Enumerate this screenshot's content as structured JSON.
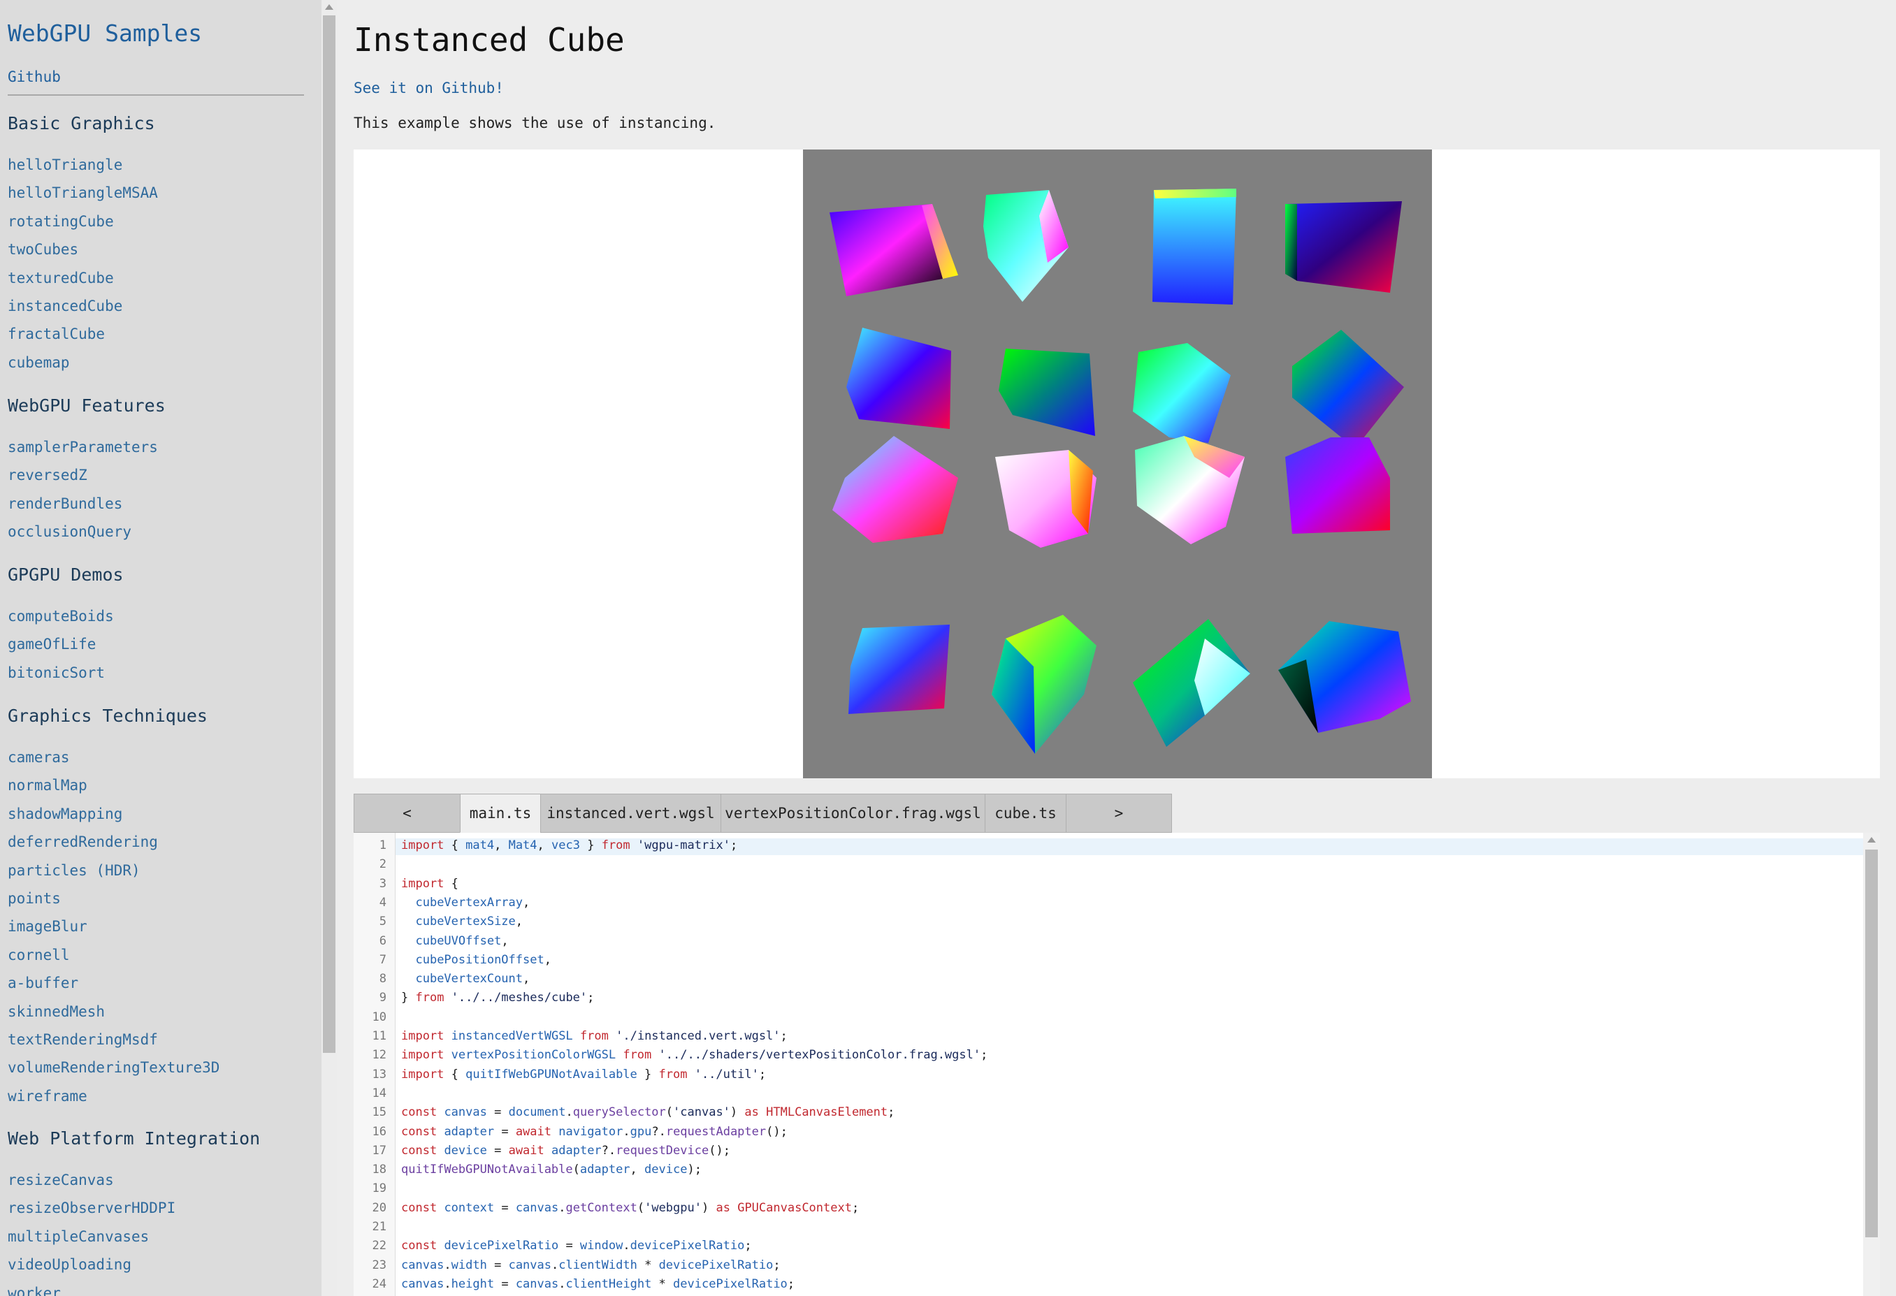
{
  "sidebar": {
    "brand": "WebGPU Samples",
    "github": "Github",
    "sections": [
      {
        "title": "Basic Graphics",
        "items": [
          "helloTriangle",
          "helloTriangleMSAA",
          "rotatingCube",
          "twoCubes",
          "texturedCube",
          "instancedCube",
          "fractalCube",
          "cubemap"
        ]
      },
      {
        "title": "WebGPU Features",
        "items": [
          "samplerParameters",
          "reversedZ",
          "renderBundles",
          "occlusionQuery"
        ]
      },
      {
        "title": "GPGPU Demos",
        "items": [
          "computeBoids",
          "gameOfLife",
          "bitonicSort"
        ]
      },
      {
        "title": "Graphics Techniques",
        "items": [
          "cameras",
          "normalMap",
          "shadowMapping",
          "deferredRendering",
          "particles (HDR)",
          "points",
          "imageBlur",
          "cornell",
          "a-buffer",
          "skinnedMesh",
          "textRenderingMsdf",
          "volumeRenderingTexture3D",
          "wireframe"
        ]
      },
      {
        "title": "Web Platform Integration",
        "items": [
          "resizeCanvas",
          "resizeObserverHDDPI",
          "multipleCanvases",
          "videoUploading",
          "worker"
        ]
      }
    ]
  },
  "main": {
    "title": "Instanced Cube",
    "github_link": "See it on Github!",
    "description": "This example shows the use of instancing."
  },
  "tabs": {
    "prev": "<",
    "items": [
      "main.ts",
      "instanced.vert.wgsl",
      "vertexPositionColor.frag.wgsl",
      "cube.ts"
    ],
    "active": "main.ts",
    "next": ">"
  },
  "code": {
    "lines": [
      [
        [
          "kw",
          "import"
        ],
        [
          "pl",
          " { "
        ],
        [
          "id",
          "mat4"
        ],
        [
          "pl",
          ", "
        ],
        [
          "id",
          "Mat4"
        ],
        [
          "pl",
          ", "
        ],
        [
          "id",
          "vec3"
        ],
        [
          "pl",
          " } "
        ],
        [
          "kw",
          "from"
        ],
        [
          "pl",
          " "
        ],
        [
          "str",
          "'wgpu-matrix'"
        ],
        [
          "pl",
          ";"
        ]
      ],
      [],
      [
        [
          "kw",
          "import"
        ],
        [
          "pl",
          " {"
        ]
      ],
      [
        [
          "pl",
          "  "
        ],
        [
          "id",
          "cubeVertexArray"
        ],
        [
          "pl",
          ","
        ]
      ],
      [
        [
          "pl",
          "  "
        ],
        [
          "id",
          "cubeVertexSize"
        ],
        [
          "pl",
          ","
        ]
      ],
      [
        [
          "pl",
          "  "
        ],
        [
          "id",
          "cubeUVOffset"
        ],
        [
          "pl",
          ","
        ]
      ],
      [
        [
          "pl",
          "  "
        ],
        [
          "id",
          "cubePositionOffset"
        ],
        [
          "pl",
          ","
        ]
      ],
      [
        [
          "pl",
          "  "
        ],
        [
          "id",
          "cubeVertexCount"
        ],
        [
          "pl",
          ","
        ]
      ],
      [
        [
          "pl",
          "} "
        ],
        [
          "kw",
          "from"
        ],
        [
          "pl",
          " "
        ],
        [
          "str",
          "'../../meshes/cube'"
        ],
        [
          "pl",
          ";"
        ]
      ],
      [],
      [
        [
          "kw",
          "import"
        ],
        [
          "pl",
          " "
        ],
        [
          "id",
          "instancedVertWGSL"
        ],
        [
          "pl",
          " "
        ],
        [
          "kw",
          "from"
        ],
        [
          "pl",
          " "
        ],
        [
          "str",
          "'./instanced.vert.wgsl'"
        ],
        [
          "pl",
          ";"
        ]
      ],
      [
        [
          "kw",
          "import"
        ],
        [
          "pl",
          " "
        ],
        [
          "id",
          "vertexPositionColorWGSL"
        ],
        [
          "pl",
          " "
        ],
        [
          "kw",
          "from"
        ],
        [
          "pl",
          " "
        ],
        [
          "str",
          "'../../shaders/vertexPositionColor.frag.wgsl'"
        ],
        [
          "pl",
          ";"
        ]
      ],
      [
        [
          "kw",
          "import"
        ],
        [
          "pl",
          " { "
        ],
        [
          "id",
          "quitIfWebGPUNotAvailable"
        ],
        [
          "pl",
          " } "
        ],
        [
          "kw",
          "from"
        ],
        [
          "pl",
          " "
        ],
        [
          "str",
          "'../util'"
        ],
        [
          "pl",
          ";"
        ]
      ],
      [],
      [
        [
          "kw",
          "const"
        ],
        [
          "pl",
          " "
        ],
        [
          "id",
          "canvas"
        ],
        [
          "pl",
          " = "
        ],
        [
          "id",
          "document"
        ],
        [
          "pl",
          "."
        ],
        [
          "fn",
          "querySelector"
        ],
        [
          "pl",
          "("
        ],
        [
          "str",
          "'canvas'"
        ],
        [
          "pl",
          ") "
        ],
        [
          "kw",
          "as"
        ],
        [
          "pl",
          " "
        ],
        [
          "kw",
          "HTMLCanvasElement"
        ],
        [
          "pl",
          ";"
        ]
      ],
      [
        [
          "kw",
          "const"
        ],
        [
          "pl",
          " "
        ],
        [
          "id",
          "adapter"
        ],
        [
          "pl",
          " = "
        ],
        [
          "kw",
          "await"
        ],
        [
          "pl",
          " "
        ],
        [
          "id",
          "navigator"
        ],
        [
          "pl",
          "."
        ],
        [
          "id",
          "gpu"
        ],
        [
          "pl",
          "?."
        ],
        [
          "fn",
          "requestAdapter"
        ],
        [
          "pl",
          "();"
        ]
      ],
      [
        [
          "kw",
          "const"
        ],
        [
          "pl",
          " "
        ],
        [
          "id",
          "device"
        ],
        [
          "pl",
          " = "
        ],
        [
          "kw",
          "await"
        ],
        [
          "pl",
          " "
        ],
        [
          "id",
          "adapter"
        ],
        [
          "pl",
          "?."
        ],
        [
          "fn",
          "requestDevice"
        ],
        [
          "pl",
          "();"
        ]
      ],
      [
        [
          "fn",
          "quitIfWebGPUNotAvailable"
        ],
        [
          "pl",
          "("
        ],
        [
          "id",
          "adapter"
        ],
        [
          "pl",
          ", "
        ],
        [
          "id",
          "device"
        ],
        [
          "pl",
          ");"
        ]
      ],
      [],
      [
        [
          "kw",
          "const"
        ],
        [
          "pl",
          " "
        ],
        [
          "id",
          "context"
        ],
        [
          "pl",
          " = "
        ],
        [
          "id",
          "canvas"
        ],
        [
          "pl",
          "."
        ],
        [
          "fn",
          "getContext"
        ],
        [
          "pl",
          "("
        ],
        [
          "str",
          "'webgpu'"
        ],
        [
          "pl",
          ") "
        ],
        [
          "kw",
          "as"
        ],
        [
          "pl",
          " "
        ],
        [
          "kw",
          "GPUCanvasContext"
        ],
        [
          "pl",
          ";"
        ]
      ],
      [],
      [
        [
          "kw",
          "const"
        ],
        [
          "pl",
          " "
        ],
        [
          "id",
          "devicePixelRatio"
        ],
        [
          "pl",
          " = "
        ],
        [
          "id",
          "window"
        ],
        [
          "pl",
          "."
        ],
        [
          "id",
          "devicePixelRatio"
        ],
        [
          "pl",
          ";"
        ]
      ],
      [
        [
          "id",
          "canvas"
        ],
        [
          "pl",
          "."
        ],
        [
          "id",
          "width"
        ],
        [
          "pl",
          " = "
        ],
        [
          "id",
          "canvas"
        ],
        [
          "pl",
          "."
        ],
        [
          "id",
          "clientWidth"
        ],
        [
          "pl",
          " * "
        ],
        [
          "id",
          "devicePixelRatio"
        ],
        [
          "pl",
          ";"
        ]
      ],
      [
        [
          "id",
          "canvas"
        ],
        [
          "pl",
          "."
        ],
        [
          "id",
          "height"
        ],
        [
          "pl",
          " = "
        ],
        [
          "id",
          "canvas"
        ],
        [
          "pl",
          "."
        ],
        [
          "id",
          "clientHeight"
        ],
        [
          "pl",
          " * "
        ],
        [
          "id",
          "devicePixelRatio"
        ],
        [
          "pl",
          ";"
        ]
      ]
    ]
  }
}
